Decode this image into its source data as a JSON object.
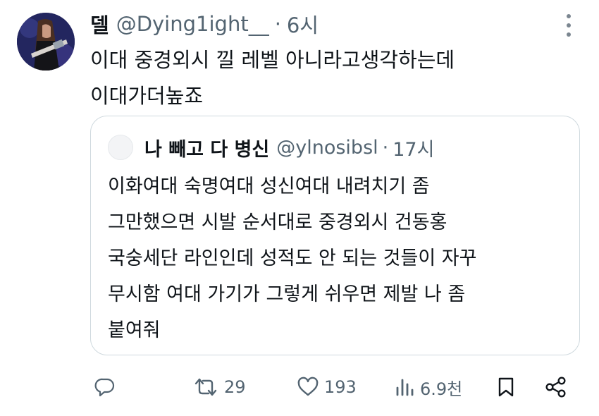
{
  "post": {
    "author_name": "델",
    "handle": "@Dying1ight__",
    "separator": "·",
    "time": "6시",
    "text_lines": [
      "이대 중경외시 낄 레벨 아니라고생각하는데",
      "이대가더높죠"
    ]
  },
  "quote": {
    "author_name": "나 빼고 다 병신",
    "handle": "@ylnosibsl",
    "separator": "·",
    "time": "17시",
    "text_lines": [
      "이화여대 숙명여대 성신여대 내려치기 좀",
      "그만했으면 시발 순서대로 중경외시 건동홍",
      "국숭세단 라인인데 성적도 안 되는 것들이 자꾸",
      "무시함 여대 가기가 그렇게 쉬우면 제발 나 좀",
      "붙여줘"
    ]
  },
  "actions": {
    "reply": {
      "icon": "reply-icon"
    },
    "retweet": {
      "icon": "retweet-icon",
      "count": "29"
    },
    "like": {
      "icon": "heart-icon",
      "count": "193"
    },
    "views": {
      "icon": "views-icon",
      "count": "6.9천"
    },
    "bookmark": {
      "icon": "bookmark-icon"
    },
    "share": {
      "icon": "share-icon"
    }
  },
  "colors": {
    "text": "#0f1419",
    "secondary": "#536471",
    "border": "#cfd9de"
  }
}
